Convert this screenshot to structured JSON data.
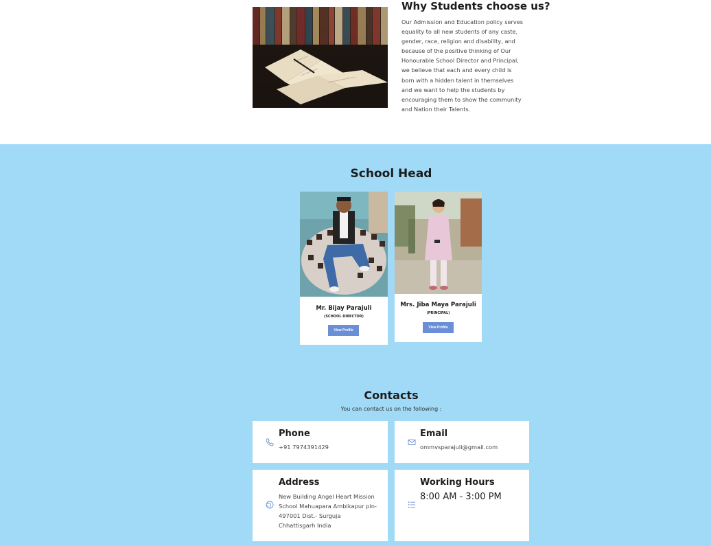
{
  "why": {
    "title": "Why Students choose us?",
    "text": "Our Admission and Education policy serves equality to all new students of any caste, gender, race, religion and disability, and because of the positive thinking of Our Honourable School Director and Principal, we believe that each and every child is born with a hidden talent in themselves and we want to help the students by encouraging them to show the community and Nation their Talents.",
    "image_icon": "open-book-photo"
  },
  "school_head": {
    "title": "School Head",
    "members": [
      {
        "name": "Mr. Bijay Parajuli",
        "role": "(SCHOOL DIRECTOR)",
        "button": "View Profile"
      },
      {
        "name": "Mrs. Jiba Maya Parajuli",
        "role": "(PRINCIPAL)",
        "button": "View Profile"
      }
    ]
  },
  "contacts": {
    "title": "Contacts",
    "subtitle": "You can contact us on the following :",
    "phone": {
      "title": "Phone",
      "value": "+91 7974391429",
      "icon": "phone-icon"
    },
    "email": {
      "title": "Email",
      "value": "ommvsparajuli@gmail.com",
      "icon": "mail-icon"
    },
    "address": {
      "title": "Address",
      "lines": [
        "New Building Angel Heart Mission",
        "School Mahuapara Ambikapur pin-",
        "497001 Dist.- Surguja",
        "Chhattisgarh India"
      ],
      "icon": "globe-icon"
    },
    "hours": {
      "title": "Working Hours",
      "value": "8:00 AM - 3:00 PM",
      "icon": "list-icon"
    }
  },
  "colors": {
    "section_bg": "#a1daf7",
    "button": "#6b8fd6",
    "icon": "#6b8fd6"
  }
}
